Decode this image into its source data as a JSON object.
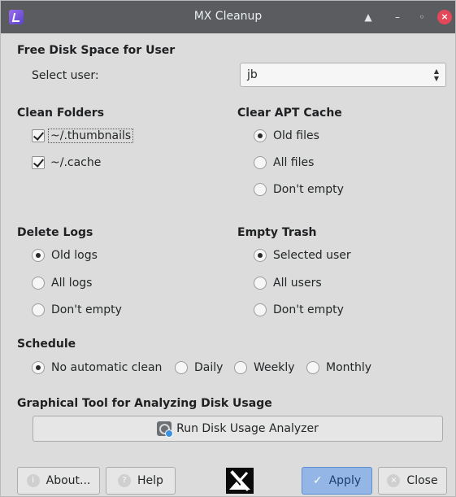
{
  "window": {
    "title": "MX Cleanup"
  },
  "free_disk": {
    "title": "Free Disk Space for User",
    "select_label": "Select user:",
    "selected_user": "jb"
  },
  "clean_folders": {
    "title": "Clean Folders",
    "items": [
      {
        "label": "~/.thumbnails",
        "checked": true
      },
      {
        "label": "~/.cache",
        "checked": true
      }
    ]
  },
  "apt_cache": {
    "title": "Clear APT Cache",
    "options": [
      "Old files",
      "All files",
      "Don't empty"
    ],
    "selected": "Old files"
  },
  "delete_logs": {
    "title": "Delete Logs",
    "options": [
      "Old logs",
      "All logs",
      "Don't empty"
    ],
    "selected": "Old logs"
  },
  "empty_trash": {
    "title": "Empty Trash",
    "options": [
      "Selected user",
      "All users",
      "Don't empty"
    ],
    "selected": "Selected user"
  },
  "schedule": {
    "title": "Schedule",
    "options": [
      "No automatic clean",
      "Daily",
      "Weekly",
      "Monthly"
    ],
    "selected": "No automatic clean"
  },
  "disk_usage": {
    "title": "Graphical Tool for Analyzing Disk Usage",
    "button_label": "Run Disk Usage Analyzer"
  },
  "buttons": {
    "about": "About...",
    "help": "Help",
    "apply": "Apply",
    "close": "Close"
  },
  "colors": {
    "titlebar": "#5a5c60",
    "window_bg": "#dcdcdc",
    "apply_button": "#93b6e6",
    "close_titlebar_button": "#e2485a"
  }
}
